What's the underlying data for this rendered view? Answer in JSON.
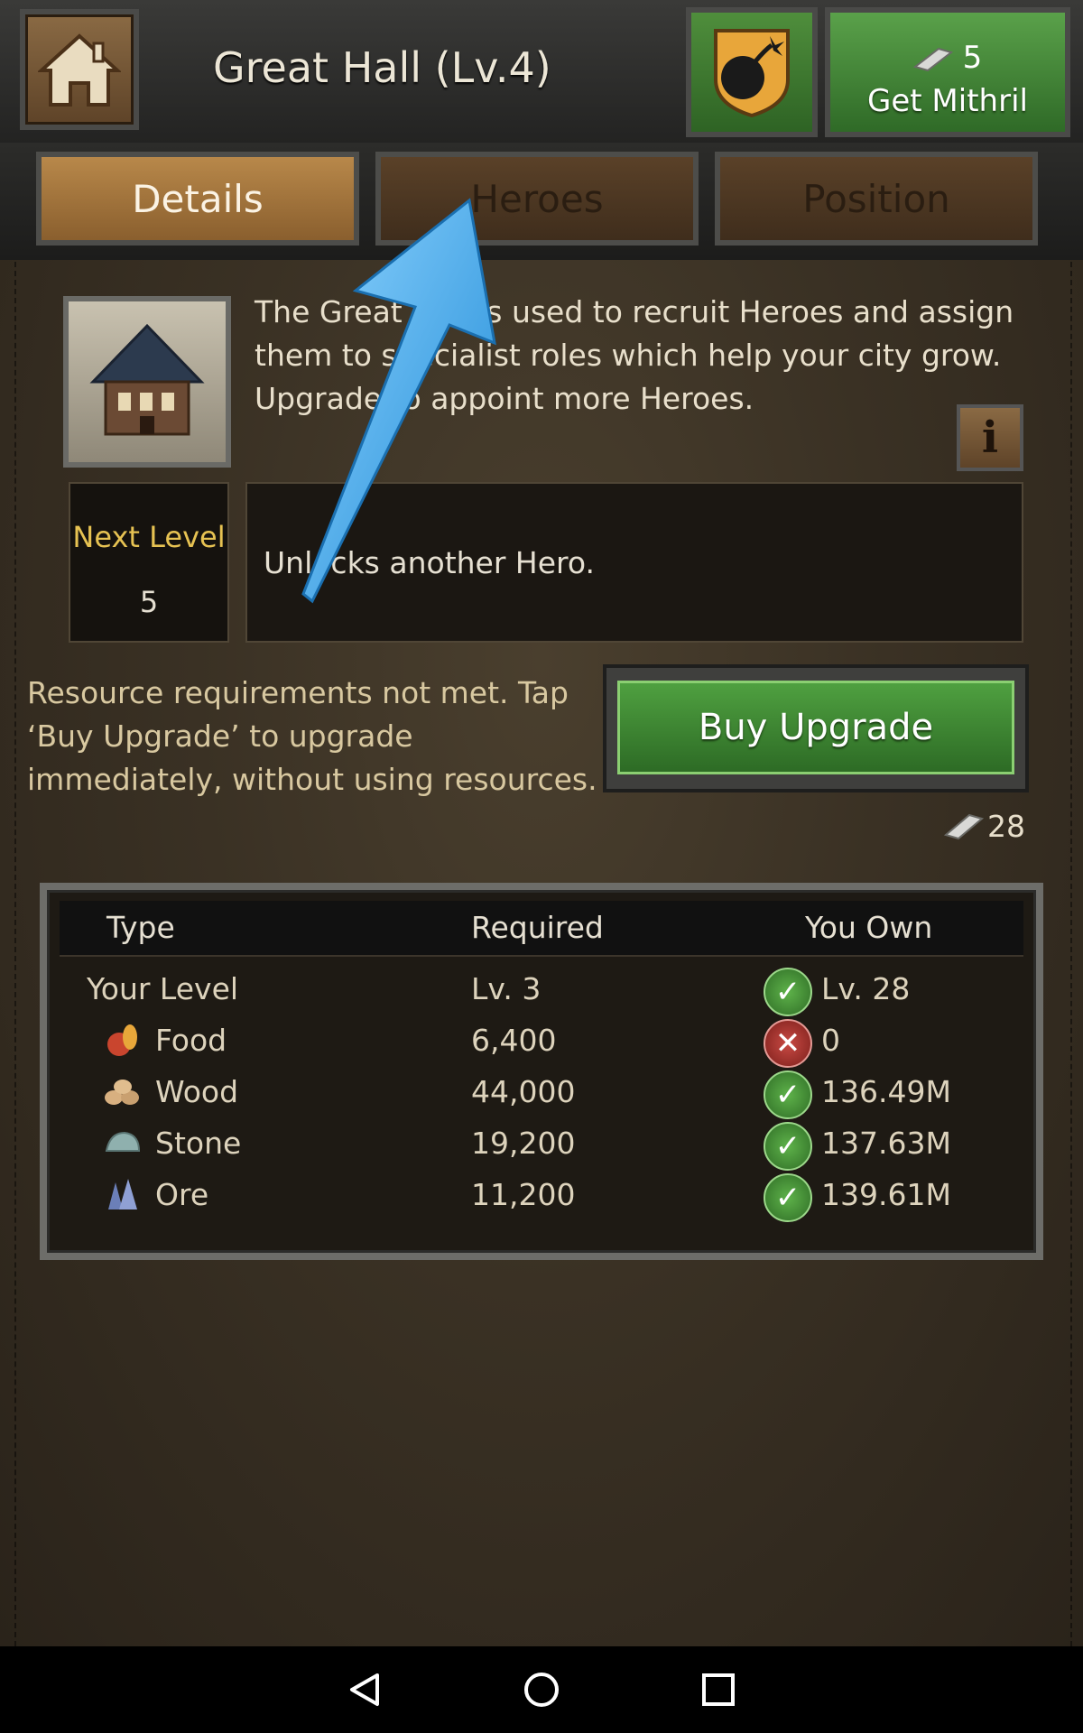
{
  "header": {
    "title": "Great Hall (Lv.4)",
    "mithril_count": "5",
    "get_mithril_label": "Get Mithril",
    "home_icon": "home-icon",
    "report_icon": "bomb-report-icon"
  },
  "tabs": [
    {
      "label": "Details",
      "active": true
    },
    {
      "label": "Heroes",
      "active": false
    },
    {
      "label": "Position",
      "active": false
    }
  ],
  "details": {
    "description": "The Great Hall is used to recruit Heroes and assign them to specialist roles which help your city grow. Upgrade to appoint more Heroes.",
    "next_level_label": "Next Level",
    "next_level_value": "5",
    "unlock_text": "Unlocks another Hero.",
    "requirement_note": "Resource requirements not met. Tap ‘Buy Upgrade’ to upgrade immediately, without using resources.",
    "buy_upgrade_label": "Buy Upgrade",
    "upgrade_cost": "28"
  },
  "requirements": {
    "headers": {
      "type": "Type",
      "required": "Required",
      "own": "You Own"
    },
    "rows": [
      {
        "type": "Your Level",
        "required": "Lv. 3",
        "own": "Lv. 28",
        "met": true,
        "icon": ""
      },
      {
        "type": "Food",
        "required": "6,400",
        "own": "0",
        "met": false,
        "icon": "food-icon"
      },
      {
        "type": "Wood",
        "required": "44,000",
        "own": "136.49M",
        "met": true,
        "icon": "wood-icon"
      },
      {
        "type": "Stone",
        "required": "19,200",
        "own": "137.63M",
        "met": true,
        "icon": "stone-icon"
      },
      {
        "type": "Ore",
        "required": "11,200",
        "own": "139.61M",
        "met": true,
        "icon": "ore-icon"
      }
    ]
  },
  "colors": {
    "accent_gold": "#e6c252",
    "button_green": "#3f8a34",
    "tab_active": "#a67a40",
    "check_green": "#4a9a3a",
    "cross_red": "#b23a35",
    "pointer_blue": "#36a6e6"
  }
}
